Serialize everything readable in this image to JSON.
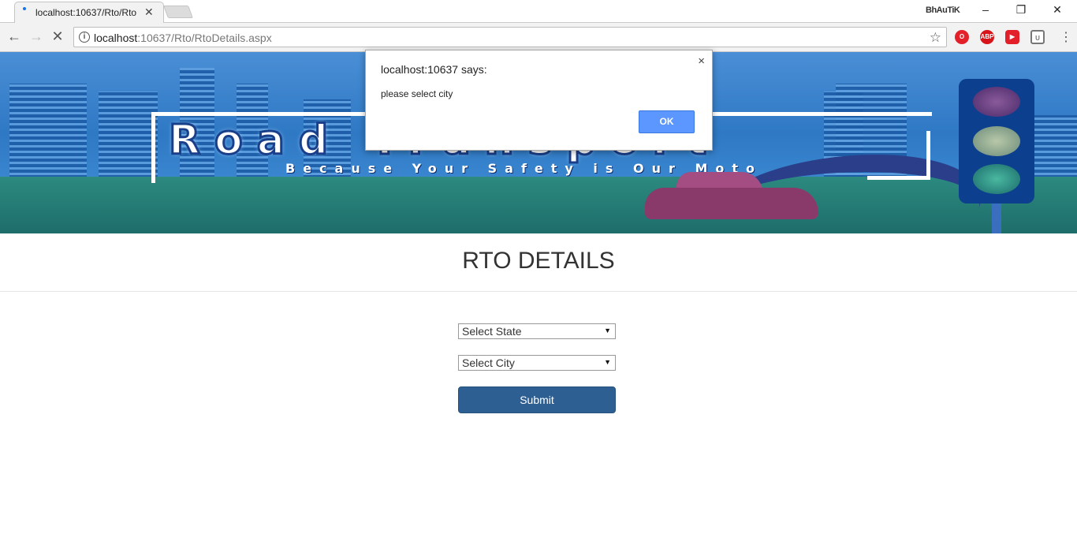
{
  "browser": {
    "tab_title": "localhost:10637/Rto/Rto",
    "user_name": "BhAuTiK",
    "url_host": "localhost",
    "url_path": ":10637/Rto/RtoDetails.aspx",
    "window_controls": {
      "minimize": "–",
      "restore": "❐",
      "close": "✕"
    },
    "extensions": [
      {
        "name": "opera-icon",
        "color": "#e3202a"
      },
      {
        "name": "adblock-plus-icon",
        "label": "ABP",
        "color": "#d7141a"
      },
      {
        "name": "video-extension-icon",
        "color": "#e3202a"
      },
      {
        "name": "shield-extension-icon",
        "color": "#777777"
      }
    ]
  },
  "banner": {
    "logo_text": "Road Transport",
    "tagline": "Because Your Safety is Our Moto"
  },
  "page": {
    "title": "RTO DETAILS",
    "state_select": {
      "selected": "Select State"
    },
    "city_select": {
      "selected": "Select City"
    },
    "submit_label": "Submit"
  },
  "dialog": {
    "title": "localhost:10637 says:",
    "message": "please select city",
    "ok_label": "OK",
    "close_glyph": "×"
  },
  "colors": {
    "submit_bg": "#2d5f93",
    "dialog_ok_bg": "#5c97ff",
    "banner_sky": "#2f78c4"
  }
}
